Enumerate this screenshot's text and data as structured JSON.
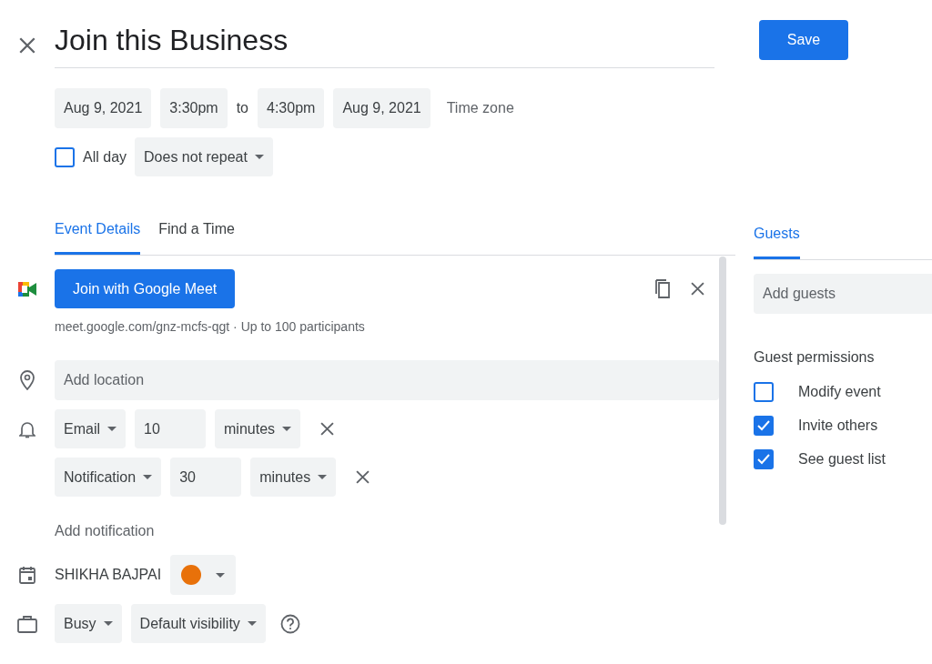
{
  "title": "Join this Business",
  "save_button": "Save",
  "start_date": "Aug 9, 2021",
  "start_time": "3:30pm",
  "to": "to",
  "end_time": "4:30pm",
  "end_date": "Aug 9, 2021",
  "time_zone": "Time zone",
  "all_day": {
    "label": "All day",
    "checked": false
  },
  "repeat": "Does not repeat",
  "tabs": [
    {
      "label": "Event Details",
      "selected": true
    },
    {
      "label": "Find a Time",
      "selected": false
    }
  ],
  "meet": {
    "button": "Join with Google Meet",
    "info": "meet.google.com/gnz-mcfs-qgt · Up to 100 participants"
  },
  "location": {
    "placeholder": "Add location"
  },
  "notifications": [
    {
      "method": "Email",
      "value": "10",
      "unit": "minutes"
    },
    {
      "method": "Notification",
      "value": "30",
      "unit": "minutes"
    }
  ],
  "add_notification": "Add notification",
  "calendar": {
    "owner": "SHIKHA BAJPAI",
    "color": "#e8710a"
  },
  "availability": "Busy",
  "visibility": "Default visibility",
  "guests": {
    "tab": {
      "label": "Guests",
      "selected": true
    },
    "placeholder": "Add guests",
    "permissions_title": "Guest permissions",
    "permissions": [
      {
        "label": "Modify event",
        "checked": false
      },
      {
        "label": "Invite others",
        "checked": true
      },
      {
        "label": "See guest list",
        "checked": true
      }
    ]
  }
}
